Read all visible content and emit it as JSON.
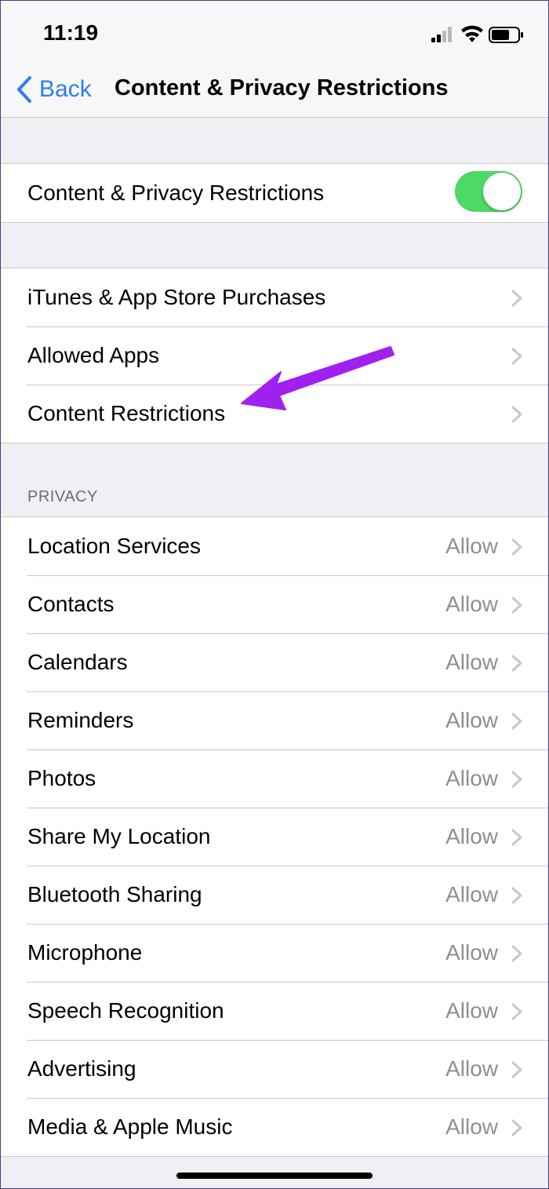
{
  "status_bar": {
    "time": "11:19"
  },
  "nav": {
    "back_label": "Back",
    "title": "Content & Privacy Restrictions"
  },
  "master": {
    "label": "Content & Privacy Restrictions",
    "enabled": true
  },
  "menu": [
    {
      "label": "iTunes & App Store Purchases"
    },
    {
      "label": "Allowed Apps"
    },
    {
      "label": "Content Restrictions"
    }
  ],
  "privacy": {
    "header": "PRIVACY",
    "items": [
      {
        "label": "Location Services",
        "value": "Allow"
      },
      {
        "label": "Contacts",
        "value": "Allow"
      },
      {
        "label": "Calendars",
        "value": "Allow"
      },
      {
        "label": "Reminders",
        "value": "Allow"
      },
      {
        "label": "Photos",
        "value": "Allow"
      },
      {
        "label": "Share My Location",
        "value": "Allow"
      },
      {
        "label": "Bluetooth Sharing",
        "value": "Allow"
      },
      {
        "label": "Microphone",
        "value": "Allow"
      },
      {
        "label": "Speech Recognition",
        "value": "Allow"
      },
      {
        "label": "Advertising",
        "value": "Allow"
      },
      {
        "label": "Media & Apple Music",
        "value": "Allow"
      }
    ]
  },
  "colors": {
    "accent": "#2f7cf6",
    "toggle_on": "#4cd964",
    "annotation_arrow": "#a020f0"
  },
  "icons": {
    "status": [
      "cellular-signal-icon",
      "wifi-icon",
      "battery-icon"
    ],
    "nav": "chevron-left-icon",
    "row": "chevron-right-icon",
    "annotation": "arrow-pointer-icon"
  }
}
